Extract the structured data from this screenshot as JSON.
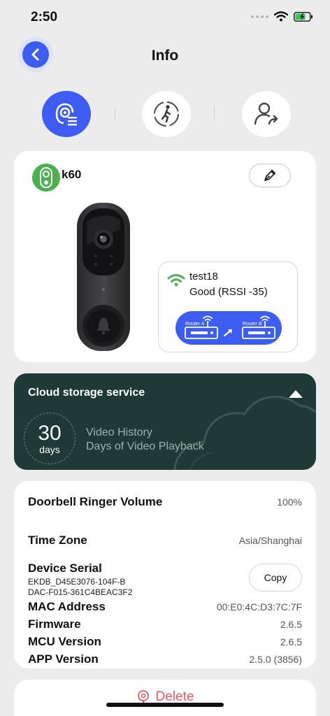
{
  "status_bar": {
    "time": "2:50"
  },
  "header": {
    "title": "Info"
  },
  "tabs": [
    {
      "icon": "device-info-icon",
      "active": true
    },
    {
      "icon": "motion-detection-icon",
      "active": false
    },
    {
      "icon": "share-user-icon",
      "active": false
    }
  ],
  "device": {
    "name": "k60",
    "wifi": {
      "ssid": "test18",
      "signal": "Good (RSSI -35)",
      "router_a": "Router A",
      "router_b": "Router B"
    }
  },
  "cloud": {
    "title": "Cloud storage service",
    "days": "30",
    "days_unit": "days",
    "line1": "Video History",
    "line2": "Days of Video Playback"
  },
  "info": {
    "ringer_volume_label": "Doorbell Ringer Volume",
    "ringer_volume_value": "100%",
    "timezone_label": "Time Zone",
    "timezone_value": "Asia/Shanghai",
    "serial_label": "Device Serial",
    "serial_line1": "EKDB_D45E3076-104F-B",
    "serial_line2": "DAC-F015-361C4BEAC3F2",
    "copy_label": "Copy",
    "mac_label": "MAC Address",
    "mac_value": "00:E0:4C:D3:7C:7F",
    "firmware_label": "Firmware",
    "firmware_value": "2.6.5",
    "mcu_label": "MCU Version",
    "mcu_value": "2.6.5",
    "app_label": "APP Version",
    "app_value": "2.5.0 (3856)"
  },
  "footer": {
    "delete_label": "Delete"
  },
  "colors": {
    "accent": "#3d5cf2",
    "cloud_bg": "#1f3a36",
    "danger": "#e85a5a",
    "online": "#4caf50"
  }
}
